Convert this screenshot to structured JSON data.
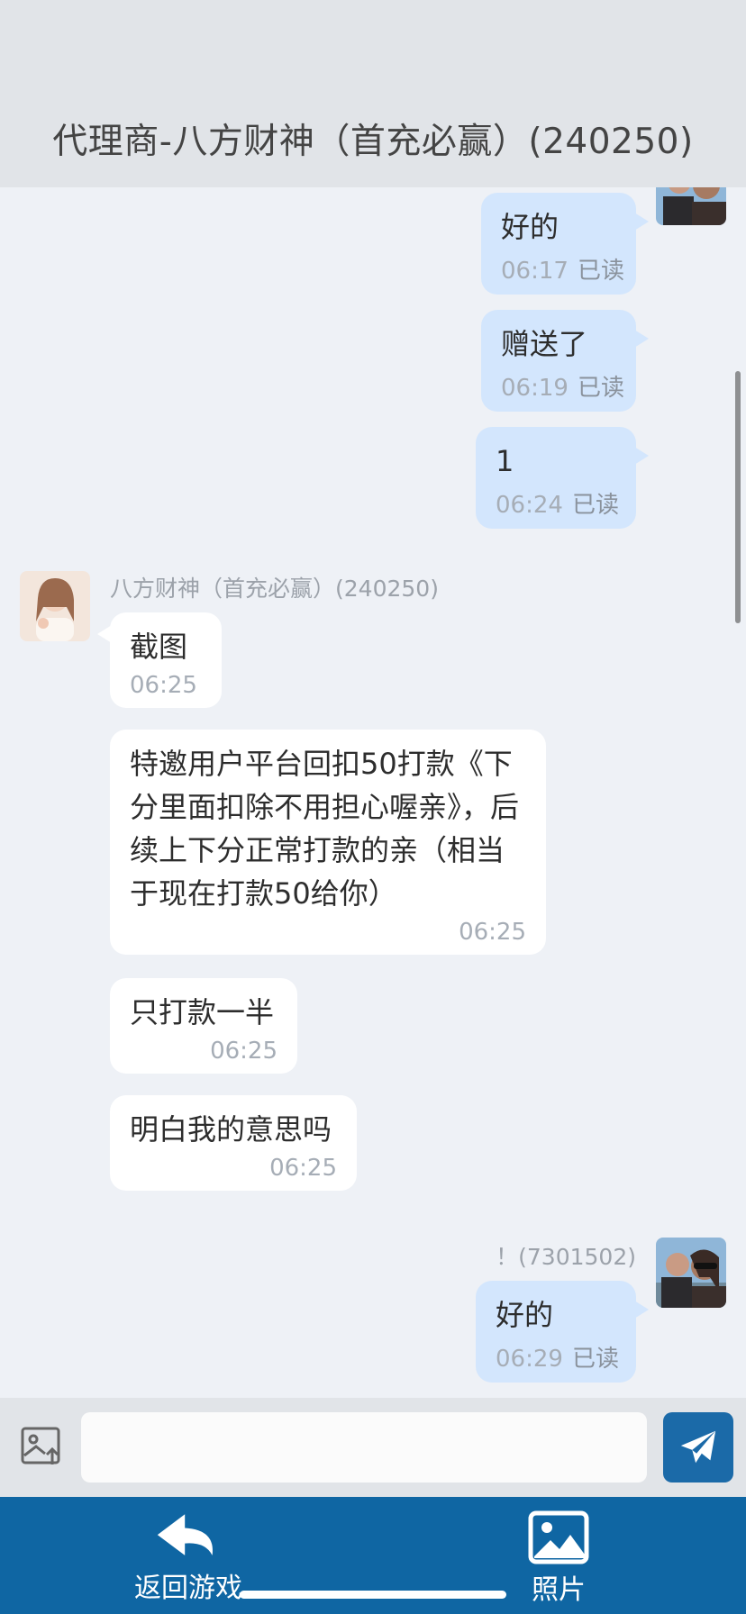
{
  "header": {
    "title": "代理商-八方财神（首充必赢）(240250)"
  },
  "messages": {
    "m1": {
      "text": "好的",
      "time": "06:17",
      "status": "已读"
    },
    "m2": {
      "text": "赠送了",
      "time": "06:19",
      "status": "已读"
    },
    "m3": {
      "text": "1",
      "time": "06:24",
      "status": "已读"
    },
    "group_in": {
      "sender": "八方财神（首充必赢）(240250)",
      "m4": {
        "text": "截图",
        "time": "06:25"
      },
      "m5": {
        "text": "特邀用户平台回扣50打款《下分里面扣除不用担心喔亲》，后续上下分正常打款的亲（相当于现在打款50给你）",
        "time": "06:25"
      },
      "m6": {
        "text": "只打款一半",
        "time": "06:25"
      },
      "m7": {
        "text": "明白我的意思吗",
        "time": "06:25"
      }
    },
    "group_out": {
      "sender": "！(7301502)",
      "m8": {
        "text": "好的",
        "time": "06:29",
        "status": "已读"
      }
    }
  },
  "input": {
    "value": "",
    "placeholder": ""
  },
  "bottom_nav": {
    "back_label": "返回游戏",
    "photo_label": "照片"
  },
  "icons": {
    "image_upload": "image-upload-icon",
    "send": "paper-plane-icon",
    "back": "back-arrow-icon",
    "photo": "photo-icon"
  },
  "colors": {
    "outgoing_bubble": "#d3e6fd",
    "incoming_bubble": "#ffffff",
    "bottom_bar": "#0f66a3",
    "send_button": "#1b6aa8"
  }
}
